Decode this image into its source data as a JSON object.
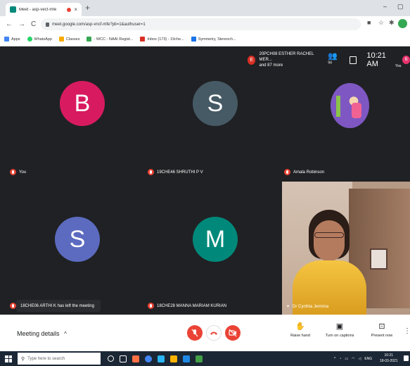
{
  "browser": {
    "tab_title": "Meet - asp-vecf-mfe",
    "tab_close": "×",
    "new_tab": "+",
    "minimize": "–",
    "restore": "▢",
    "back": "←",
    "forward": "→",
    "reload": "C",
    "url": "meet.google.com/asp-vncf-mfe?pli=1&authuser=1",
    "bookmarks": [
      {
        "label": "Apps",
        "color": "#4285f4"
      },
      {
        "label": "WhatsApp",
        "color": "#25d366"
      },
      {
        "label": "Classes",
        "color": "#f9ab00"
      },
      {
        "label": "- WCC - NAAI Regist...",
        "color": "#34a853"
      },
      {
        "label": "Inbox (173) - 19che...",
        "color": "#d93025"
      },
      {
        "label": "Symmetry, Stereoch...",
        "color": "#1a73e8"
      }
    ]
  },
  "meeting": {
    "top_participant_initial": "E",
    "top_participant_text": "20PCH08 ESTHER RACHEL MER...",
    "top_participant_more": "and 87 more",
    "people_count": "94",
    "time": "10:21 AM",
    "self_initial": "B",
    "self_label": "You",
    "tiles": [
      {
        "initial": "B",
        "name": "You",
        "color": "#d81b60"
      },
      {
        "initial": "S",
        "name": "19CHE46 SHRUTHI P V",
        "color": "#455a64"
      },
      {
        "initial": "",
        "name": "Amala Robinson",
        "color": "#7e57c2"
      },
      {
        "initial": "S",
        "name": "18CHE06 ARTHI K",
        "color": "#5c6bc0"
      },
      {
        "initial": "M",
        "name": "18CHE28 MANNA MARIAM KURIAN",
        "color": "#00897b"
      },
      {
        "initial": "",
        "name": "Dr Cynthia Jemima",
        "color": ""
      }
    ],
    "toast": "18CHE06 ARTHI K has left the meeting"
  },
  "bottom_bar": {
    "meeting_details": "Meeting details",
    "details_chevron": "^",
    "raise_hand": "Raise hand",
    "captions": "Turn on captions",
    "present": "Present now",
    "more": "⋮"
  },
  "taskbar": {
    "search_placeholder": "Type here to search",
    "tray_lang": "ENG",
    "tray_time": "10:21",
    "tray_date": "18-03-2021"
  }
}
